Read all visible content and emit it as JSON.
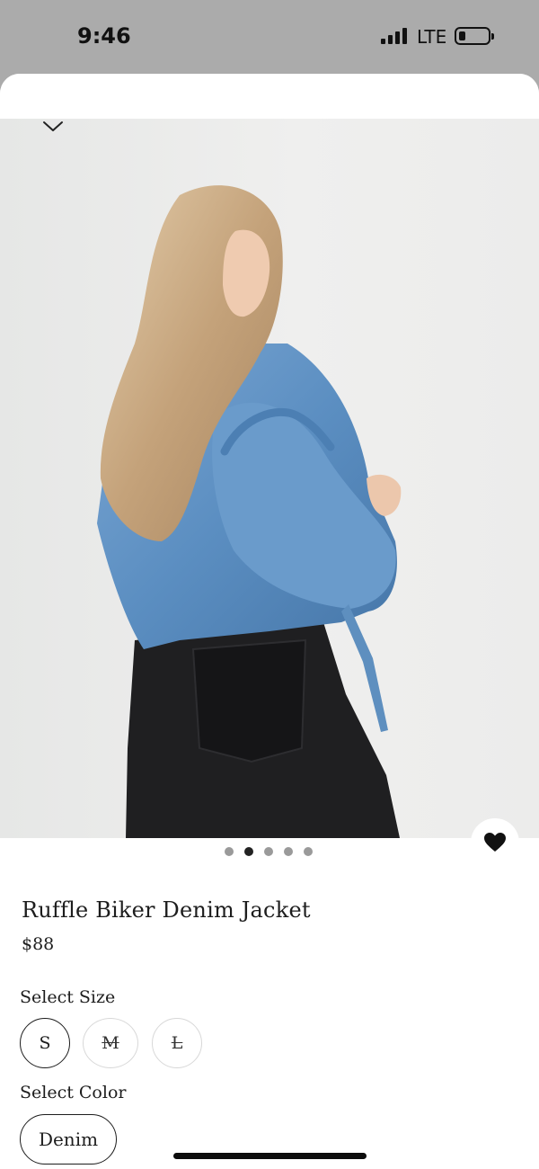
{
  "status_bar": {
    "time": "9:46",
    "network": "LTE",
    "battery_level": 0.2
  },
  "product": {
    "title": "Ruffle Biker Denim Jacket",
    "price": "$88",
    "gallery": {
      "image_count": 5,
      "active_index": 1
    },
    "favorited": true
  },
  "size_selector": {
    "label": "Select Size",
    "options": [
      {
        "label": "S",
        "selected": true,
        "available": true
      },
      {
        "label": "M",
        "selected": false,
        "available": false
      },
      {
        "label": "L",
        "selected": false,
        "available": false
      }
    ]
  },
  "color_selector": {
    "label": "Select Color",
    "options": [
      {
        "label": "Denim",
        "selected": true
      }
    ]
  },
  "colors": {
    "text": "#1d1d1d",
    "status_background": "#ababab",
    "denim": "#5b8ec1",
    "jeans": "#1f1f21",
    "hair": "#c9ab83"
  },
  "icons": {
    "collapse": "chevron-down-icon",
    "favorite": "heart-icon"
  }
}
